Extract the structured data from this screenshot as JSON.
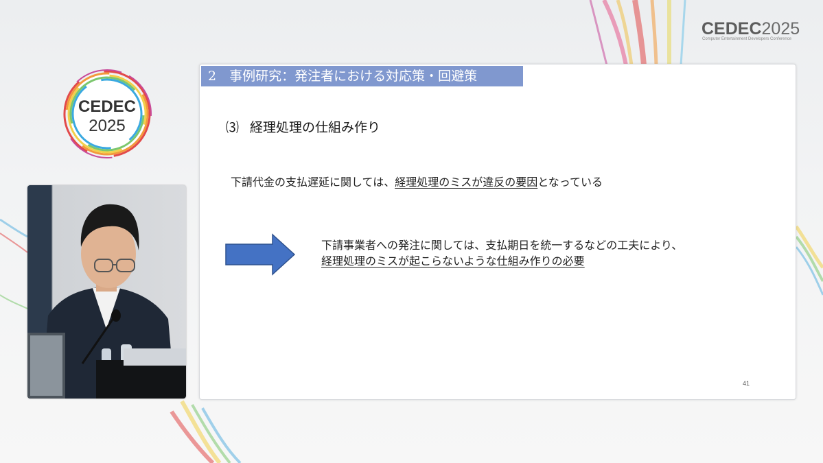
{
  "branding": {
    "logo_top_main": "CEDEC",
    "logo_top_year": "2025",
    "logo_top_subtitle": "Computer Entertainment Developers Conference",
    "ring_logo_main": "CEDEC",
    "ring_logo_year": "2025"
  },
  "slide": {
    "header": "2　事例研究：発注者における対応策・回避策",
    "section_number": "⑶",
    "section_title": "経理処理の仕組み作り",
    "line1_prefix": "下請代金の支払遅延に関しては、",
    "line1_emphasis": "経理処理のミスが違反の要因",
    "line1_suffix": "となっている",
    "line2": "下請事業者への発注に関しては、支払期日を統一するなどの工夫により、",
    "line3_emphasis": "経理処理のミスが起こらないような仕組み作りの必要",
    "page_number": "41"
  },
  "colors": {
    "header_bg": "#8098cf",
    "arrow_fill": "#4472c4",
    "arrow_stroke": "#2f528f"
  }
}
